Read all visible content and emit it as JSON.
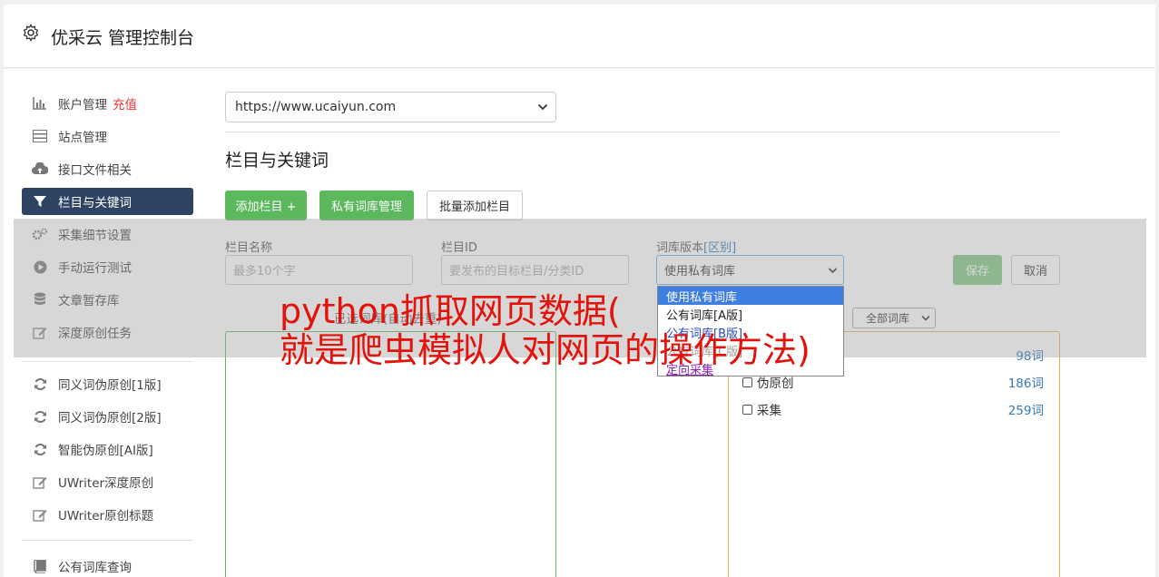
{
  "header": {
    "title": "优采云 管理控制台",
    "icon": "gear-icon"
  },
  "sidebar": {
    "group1": [
      {
        "label": "账户管理",
        "icon": "bar-chart-icon",
        "badge": "充值"
      },
      {
        "label": "站点管理",
        "icon": "server-icon"
      },
      {
        "label": "接口文件相关",
        "icon": "cloud-upload-icon"
      },
      {
        "label": "栏目与关键词",
        "icon": "filter-icon",
        "active": true
      },
      {
        "label": "采集细节设置",
        "icon": "gears-icon"
      },
      {
        "label": "手动运行测试",
        "icon": "play-circle-icon"
      },
      {
        "label": "文章暂存库",
        "icon": "database-icon"
      },
      {
        "label": "深度原创任务",
        "icon": "edit-icon"
      }
    ],
    "group2": [
      {
        "label": "同义词伪原创[1版]",
        "icon": "refresh-icon"
      },
      {
        "label": "同义词伪原创[2版]",
        "icon": "refresh-icon"
      },
      {
        "label": "智能伪原创[AI版]",
        "icon": "refresh-icon"
      },
      {
        "label": "UWriter深度原创",
        "icon": "edit-icon"
      },
      {
        "label": "UWriter原创标题",
        "icon": "edit-icon"
      }
    ],
    "group3": [
      {
        "label": "公有词库查询",
        "icon": "book-icon"
      }
    ]
  },
  "main": {
    "site_select": "https://www.ucaiyun.com",
    "section_title": "栏目与关键词",
    "buttons": {
      "add_column": "添加栏目 +",
      "private_lib": "私有词库管理",
      "batch_add": "批量添加栏目"
    },
    "form": {
      "name_label": "栏目名称",
      "name_placeholder": "最多10个字",
      "id_label": "栏目ID",
      "id_placeholder": "要发布的目标栏目/分类ID",
      "lib_label": "词库版本",
      "lib_link": "[区别]",
      "lib_value": "使用私有词库",
      "save": "保存",
      "cancel": "取消"
    },
    "dropdown_options": [
      "使用私有词库",
      "公有词库[A版]",
      "公有词库[B版]",
      "公有词库[C版]",
      "定向采集"
    ],
    "hint": "已选词库(自动去重)",
    "all_lib_select": "全部词库",
    "wordlists": [
      {
        "name": "",
        "count": "98词"
      },
      {
        "name": "伪原创",
        "count": "186词"
      },
      {
        "name": "采集",
        "count": "259词"
      }
    ]
  },
  "banner": {
    "line1": "python抓取网页数据(",
    "line2": "就是爬虫模拟人对网页的操作方法)"
  },
  "colors": {
    "active_nav": "#2e4462",
    "green": "#5cb85c",
    "orange": "#f0ad4e",
    "banner": "#e3120b"
  }
}
